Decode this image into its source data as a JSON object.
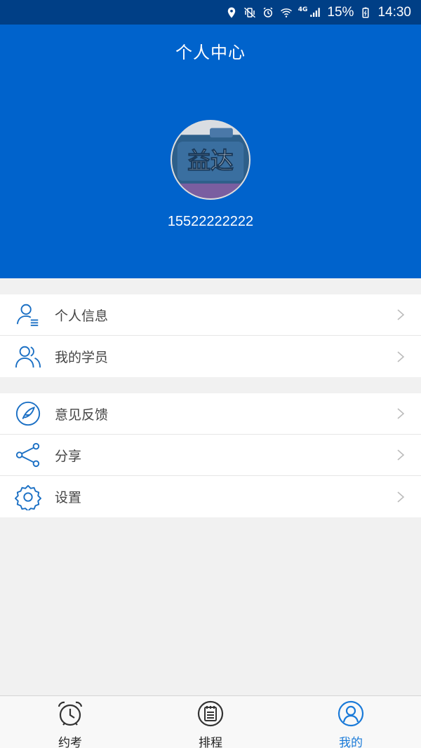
{
  "status_bar": {
    "network": "4G",
    "battery": "15%",
    "time": "14:30",
    "icons": [
      "location-icon",
      "vibrate-mute-icon",
      "alarm-icon",
      "wifi-icon",
      "signal-icon",
      "battery-icon"
    ]
  },
  "header": {
    "title": "个人中心",
    "phone": "15522222222",
    "bg_color": "#0063cc"
  },
  "menu_group1": [
    {
      "label": "个人信息",
      "icon": "personal-info-icon"
    },
    {
      "label": "我的学员",
      "icon": "students-icon"
    }
  ],
  "menu_group2": [
    {
      "label": "意见反馈",
      "icon": "feedback-icon"
    },
    {
      "label": "分享",
      "icon": "share-icon"
    },
    {
      "label": "设置",
      "icon": "settings-icon"
    }
  ],
  "tabbar": {
    "tabs": [
      {
        "label": "约考",
        "icon": "alarm-clock-icon",
        "active": false
      },
      {
        "label": "排程",
        "icon": "schedule-icon",
        "active": false
      },
      {
        "label": "我的",
        "icon": "profile-icon",
        "active": true
      }
    ],
    "active_color": "#1a7ad8"
  },
  "colors": {
    "accent": "#1a6fc4",
    "status_bar": "#003f86"
  }
}
